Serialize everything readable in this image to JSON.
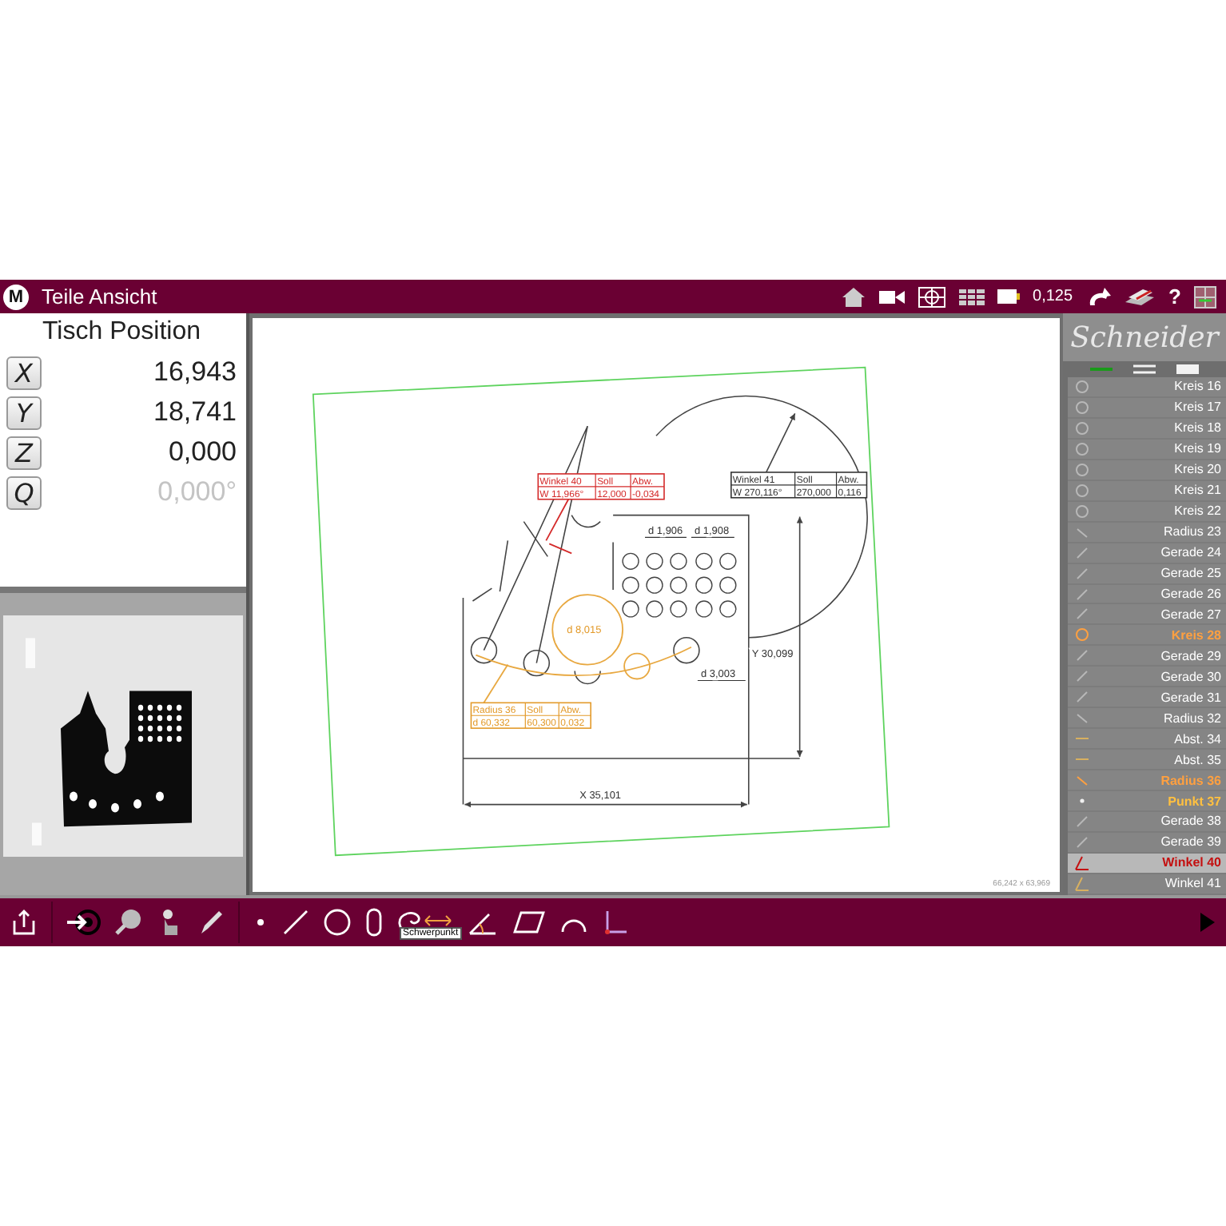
{
  "title_bar": {
    "logo": "M",
    "title": "Teile Ansicht",
    "zoom_value": "0,125",
    "help": "?"
  },
  "position_panel": {
    "title": "Tisch Position",
    "axes": [
      {
        "label": "X",
        "value": "16,943",
        "disabled": false
      },
      {
        "label": "Y",
        "value": "18,741",
        "disabled": false
      },
      {
        "label": "Z",
        "value": "0,000",
        "disabled": false
      },
      {
        "label": "Q",
        "value": "0,000°",
        "disabled": true
      }
    ]
  },
  "drawing": {
    "tables": [
      {
        "header": [
          "Winkel 40",
          "Soll",
          "Abw."
        ],
        "values": [
          "W 11,966°",
          "12,000",
          "-0,034"
        ],
        "color": "#d42a2a"
      },
      {
        "header": [
          "Winkel 41",
          "Soll",
          "Abw."
        ],
        "values": [
          "W 270,116°",
          "270,000",
          "0,116"
        ],
        "color": "#333333"
      },
      {
        "header": [
          "Radius 36",
          "Soll",
          "Abw."
        ],
        "values": [
          "d   60,332",
          "60,300",
          "0,032"
        ],
        "color": "#e39a2a"
      }
    ],
    "labels": [
      {
        "text": "d  1,906",
        "color": "#333333"
      },
      {
        "text": "d  1,908",
        "color": "#333333"
      },
      {
        "text": "d  8,015",
        "color": "#e39a2a"
      },
      {
        "text": "d  3,003",
        "color": "#333333"
      },
      {
        "text": "Y  30,099",
        "color": "#333333"
      },
      {
        "text": "X  35,101",
        "color": "#333333"
      }
    ],
    "scale": "66,242 x 63,969"
  },
  "feature_panel": {
    "logo": "Schneider",
    "views": [
      {
        "kind": "line",
        "selected": true
      },
      {
        "kind": "list",
        "selected": false
      },
      {
        "kind": "block",
        "selected": false
      }
    ],
    "items": [
      {
        "name": "Kreis 16",
        "kind": "circle",
        "color": "#ffffff",
        "selected": false
      },
      {
        "name": "Kreis 17",
        "kind": "circle",
        "color": "#ffffff",
        "selected": false
      },
      {
        "name": "Kreis 18",
        "kind": "circle",
        "color": "#ffffff",
        "selected": false
      },
      {
        "name": "Kreis 19",
        "kind": "circle",
        "color": "#ffffff",
        "selected": false
      },
      {
        "name": "Kreis 20",
        "kind": "circle",
        "color": "#ffffff",
        "selected": false
      },
      {
        "name": "Kreis 21",
        "kind": "circle",
        "color": "#ffffff",
        "selected": false
      },
      {
        "name": "Kreis 22",
        "kind": "circle",
        "color": "#ffffff",
        "selected": false
      },
      {
        "name": "Radius 23",
        "kind": "radius",
        "color": "#ffffff",
        "selected": false
      },
      {
        "name": "Gerade 24",
        "kind": "line",
        "color": "#ffffff",
        "selected": false
      },
      {
        "name": "Gerade 25",
        "kind": "line",
        "color": "#ffffff",
        "selected": false
      },
      {
        "name": "Gerade 26",
        "kind": "line",
        "color": "#ffffff",
        "selected": false
      },
      {
        "name": "Gerade 27",
        "kind": "line",
        "color": "#ffffff",
        "selected": false
      },
      {
        "name": "Kreis 28",
        "kind": "circle",
        "color": "#ffa040",
        "selected": false
      },
      {
        "name": "Gerade 29",
        "kind": "line",
        "color": "#ffffff",
        "selected": false
      },
      {
        "name": "Gerade 30",
        "kind": "line",
        "color": "#ffffff",
        "selected": false
      },
      {
        "name": "Gerade 31",
        "kind": "line",
        "color": "#ffffff",
        "selected": false
      },
      {
        "name": "Radius 32",
        "kind": "radius",
        "color": "#ffffff",
        "selected": false
      },
      {
        "name": "Abst. 34",
        "kind": "distance",
        "color": "#ffffff",
        "selected": false
      },
      {
        "name": "Abst. 35",
        "kind": "distance",
        "color": "#ffffff",
        "selected": false
      },
      {
        "name": "Radius 36",
        "kind": "radius",
        "color": "#ffa040",
        "selected": false
      },
      {
        "name": "Punkt 37",
        "kind": "point",
        "color": "#ffc040",
        "selected": false
      },
      {
        "name": "Gerade 38",
        "kind": "line",
        "color": "#ffffff",
        "selected": false
      },
      {
        "name": "Gerade 39",
        "kind": "line",
        "color": "#ffffff",
        "selected": false
      },
      {
        "name": "Winkel 40",
        "kind": "angle",
        "color": "#c41010",
        "selected": true
      },
      {
        "name": "Winkel 41",
        "kind": "angle",
        "color": "#ffffff",
        "selected": false
      }
    ]
  },
  "toolbar": {
    "tooltip": "Schwerpunkt"
  }
}
